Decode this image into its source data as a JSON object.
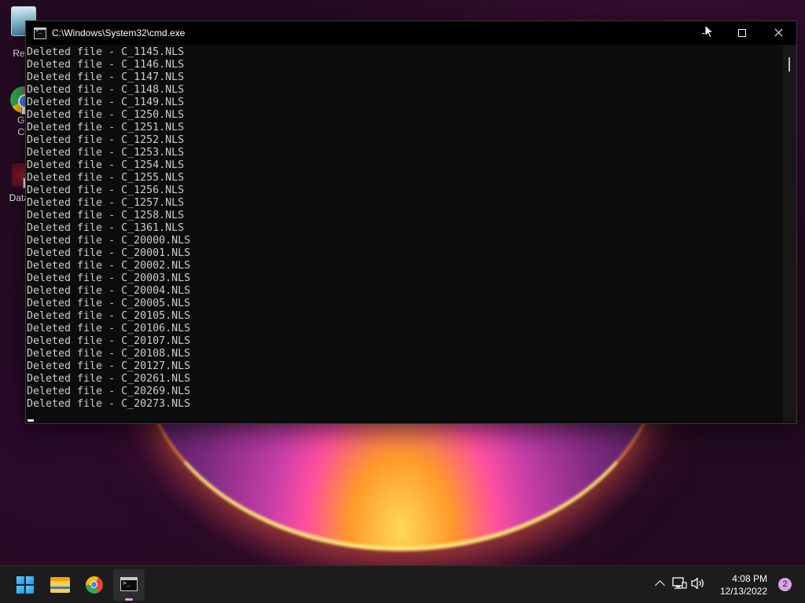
{
  "desktop": {
    "icons": [
      {
        "label": "Recy",
        "icon": "recycle-bin-icon"
      },
      {
        "label": "Go\nCh",
        "icon": "chrome-icon"
      },
      {
        "label": "DataW",
        "icon": "datawrapper-icon"
      }
    ]
  },
  "window": {
    "title": "C:\\Windows\\System32\\cmd.exe",
    "icon": "cmd-icon",
    "buttons": {
      "minimize": "minimize-icon",
      "maximize": "maximize-icon",
      "close": "close-icon"
    },
    "console_lines": [
      "Deleted file - C_1145.NLS",
      "Deleted file - C_1146.NLS",
      "Deleted file - C_1147.NLS",
      "Deleted file - C_1148.NLS",
      "Deleted file - C_1149.NLS",
      "Deleted file - C_1250.NLS",
      "Deleted file - C_1251.NLS",
      "Deleted file - C_1252.NLS",
      "Deleted file - C_1253.NLS",
      "Deleted file - C_1254.NLS",
      "Deleted file - C_1255.NLS",
      "Deleted file - C_1256.NLS",
      "Deleted file - C_1257.NLS",
      "Deleted file - C_1258.NLS",
      "Deleted file - C_1361.NLS",
      "Deleted file - C_20000.NLS",
      "Deleted file - C_20001.NLS",
      "Deleted file - C_20002.NLS",
      "Deleted file - C_20003.NLS",
      "Deleted file - C_20004.NLS",
      "Deleted file - C_20005.NLS",
      "Deleted file - C_20105.NLS",
      "Deleted file - C_20106.NLS",
      "Deleted file - C_20107.NLS",
      "Deleted file - C_20108.NLS",
      "Deleted file - C_20127.NLS",
      "Deleted file - C_20261.NLS",
      "Deleted file - C_20269.NLS",
      "Deleted file - C_20273.NLS"
    ]
  },
  "taskbar": {
    "apps": [
      {
        "name": "start",
        "icon": "windows-start-icon",
        "active": false
      },
      {
        "name": "file-explorer",
        "icon": "folder-icon",
        "active": false
      },
      {
        "name": "chrome",
        "icon": "chrome-icon",
        "active": false
      },
      {
        "name": "command-prompt",
        "icon": "cmd-icon",
        "active": true
      }
    ],
    "tray": {
      "icons": [
        "chevron-up-icon",
        "network-icon",
        "volume-icon"
      ],
      "time": "4:08 PM",
      "date": "12/13/2022",
      "notification_count": "2"
    }
  },
  "colors": {
    "console_bg": "#0c0c0c",
    "console_text": "#cccccc",
    "taskbar_bg": "#1c1c1c",
    "badge": "#d9a3e6"
  }
}
